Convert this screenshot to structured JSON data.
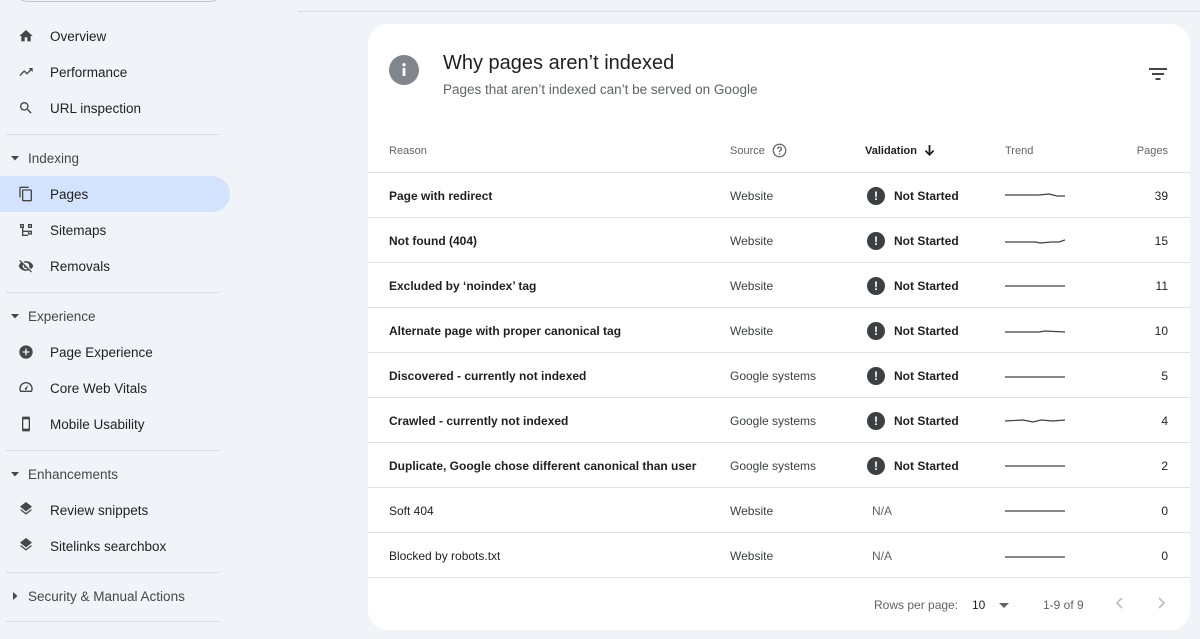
{
  "sidebar": {
    "top_items": [
      {
        "label": "Overview",
        "icon": "home-icon"
      },
      {
        "label": "Performance",
        "icon": "trending-up-icon"
      },
      {
        "label": "URL inspection",
        "icon": "search-icon"
      }
    ],
    "sections": [
      {
        "label": "Indexing",
        "expanded": true,
        "items": [
          {
            "label": "Pages",
            "icon": "pages-icon",
            "active": true
          },
          {
            "label": "Sitemaps",
            "icon": "sitemap-icon"
          },
          {
            "label": "Removals",
            "icon": "eye-off-icon"
          }
        ]
      },
      {
        "label": "Experience",
        "expanded": true,
        "items": [
          {
            "label": "Page Experience",
            "icon": "plus-circle-icon"
          },
          {
            "label": "Core Web Vitals",
            "icon": "gauge-icon"
          },
          {
            "label": "Mobile Usability",
            "icon": "phone-icon"
          }
        ]
      },
      {
        "label": "Enhancements",
        "expanded": true,
        "items": [
          {
            "label": "Review snippets",
            "icon": "layers-icon"
          },
          {
            "label": "Sitelinks searchbox",
            "icon": "layers-icon"
          }
        ]
      },
      {
        "label": "Security & Manual Actions",
        "expanded": false,
        "items": []
      }
    ]
  },
  "card": {
    "title": "Why pages aren’t indexed",
    "subtitle": "Pages that aren’t indexed can’t be served on Google",
    "columns": {
      "reason": "Reason",
      "source": "Source",
      "validation": "Validation",
      "trend": "Trend",
      "pages": "Pages"
    },
    "rows": [
      {
        "reason": "Page with redirect",
        "source": "Website",
        "validation": "Not Started",
        "pages": "39"
      },
      {
        "reason": "Not found (404)",
        "source": "Website",
        "validation": "Not Started",
        "pages": "15"
      },
      {
        "reason": "Excluded by ‘noindex’ tag",
        "source": "Website",
        "validation": "Not Started",
        "pages": "11"
      },
      {
        "reason": "Alternate page with proper canonical tag",
        "source": "Website",
        "validation": "Not Started",
        "pages": "10"
      },
      {
        "reason": "Discovered - currently not indexed",
        "source": "Google systems",
        "validation": "Not Started",
        "pages": "5"
      },
      {
        "reason": "Crawled - currently not indexed",
        "source": "Google systems",
        "validation": "Not Started",
        "pages": "4"
      },
      {
        "reason": "Duplicate, Google chose different canonical than user",
        "source": "Google systems",
        "validation": "Not Started",
        "pages": "2"
      },
      {
        "reason": "Soft 404",
        "source": "Website",
        "validation": "N/A",
        "pages": "0"
      },
      {
        "reason": "Blocked by robots.txt",
        "source": "Website",
        "validation": "N/A",
        "pages": "0"
      }
    ],
    "footer": {
      "rows_per_page_label": "Rows per page:",
      "rows_per_page": "10",
      "range": "1-9 of 9"
    }
  },
  "colors": {
    "active_nav": "#d3e3fd",
    "background": "#f0f4f9",
    "status_icon": "#3c4043"
  }
}
